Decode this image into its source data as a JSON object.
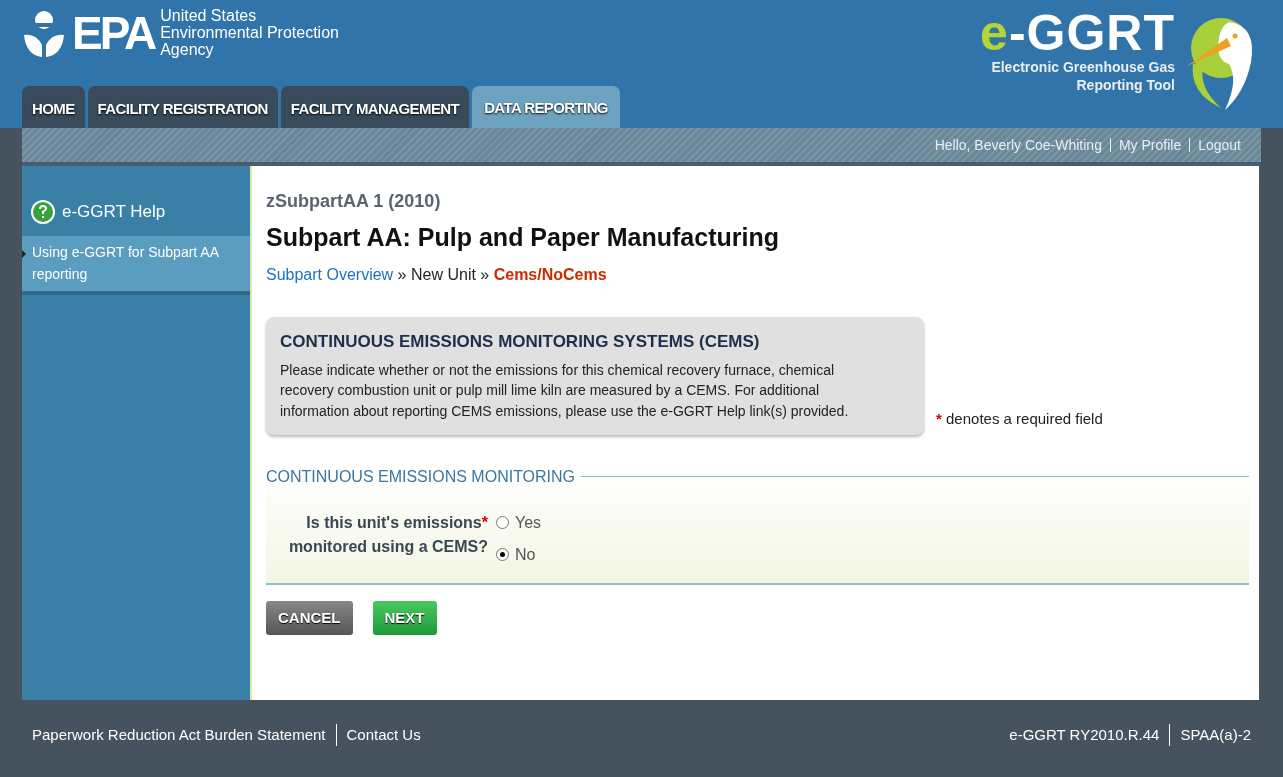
{
  "header": {
    "agency": {
      "mark": "EPA",
      "name_lines": [
        "United States",
        "Environmental Protection",
        "Agency"
      ]
    },
    "tool": {
      "prefix": "e",
      "name": "-GGRT",
      "tagline_lines": [
        "Electronic Greenhouse Gas",
        "Reporting Tool"
      ]
    },
    "tabs": [
      {
        "label": "HOME",
        "selected": false
      },
      {
        "label": "FACILITY REGISTRATION",
        "selected": false
      },
      {
        "label": "FACILITY MANAGEMENT",
        "selected": false
      },
      {
        "label": "DATA REPORTING",
        "selected": true
      }
    ]
  },
  "user_bar": {
    "greeting": "Hello, Beverly Coe-Whiting",
    "links": [
      "My Profile",
      "Logout"
    ]
  },
  "sidebar": {
    "help": "e-GGRT Help",
    "items": [
      {
        "label": "Using e-GGRT for Subpart AA reporting",
        "selected": true
      }
    ]
  },
  "content": {
    "subtitle": "zSubpartAA 1 (2010)",
    "title": "Subpart AA: Pulp and Paper Manufacturing",
    "breadcrumb": {
      "separator": "»",
      "items": [
        {
          "label": "Subpart Overview",
          "kind": "link"
        },
        {
          "label": "New Unit",
          "kind": "plain"
        },
        {
          "label": "Cems/NoCems",
          "kind": "current"
        }
      ]
    },
    "info": {
      "heading": "CONTINUOUS EMISSIONS MONITORING SYSTEMS (CEMS)",
      "text": "Please indicate whether or not the emissions for this chemical recovery furnace, chemical recovery combustion unit or pulp mill lime kiln are measured by a CEMS. For additional information about reporting CEMS emissions, please use the e-GGRT Help link(s) provided."
    },
    "required_note": {
      "mark": "*",
      "text": "denotes a required field"
    },
    "section": {
      "title": "CONTINUOUS EMISSIONS MONITORING",
      "question_lines": [
        "Is this unit's emissions",
        "monitored using a CEMS?"
      ],
      "required_mark": "*",
      "options": [
        {
          "label": "Yes",
          "selected": false
        },
        {
          "label": "No",
          "selected": true
        }
      ]
    },
    "buttons": [
      {
        "label": "CANCEL",
        "kind": "cancel"
      },
      {
        "label": "NEXT",
        "kind": "next"
      }
    ]
  },
  "footer": {
    "left": [
      "Paperwork Reduction Act Burden Statement",
      "Contact Us"
    ],
    "right": [
      "e-GGRT RY2010.R.44",
      "SPAA(a)-2"
    ]
  }
}
